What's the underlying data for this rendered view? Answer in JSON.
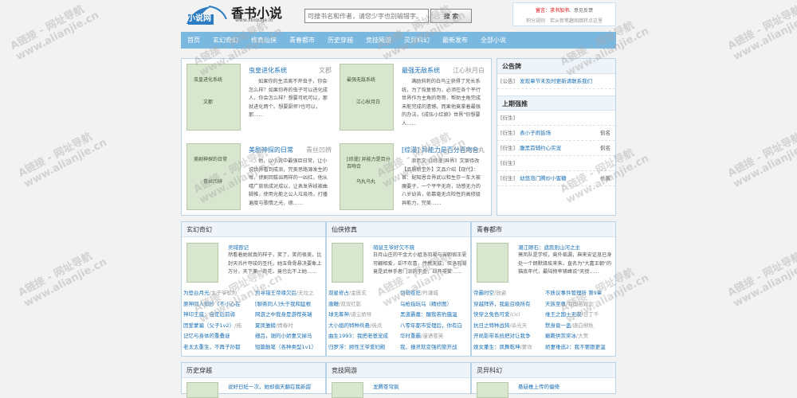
{
  "header": {
    "logo_text": "小说网",
    "site_title": "香书小说",
    "site_url": "www.xbiquge.lo",
    "search_placeholder": "可搜书名和作者，请您少字也别输错字。",
    "search_button": "搜 索",
    "notice_prefix": "留言：",
    "notice_link": "求书加书",
    "notice_sep": "、意见反馈",
    "notice_line2": "积分规则　若从新笔趣阁跳转点这里"
  },
  "nav": [
    "首页",
    "玄幻奇幻",
    "修真仙侠",
    "青春都市",
    "历史穿越",
    "竞技网游",
    "灵异科幻",
    "最新发布",
    "全部小说"
  ],
  "featured": [
    {
      "title": "虫皇进化系统",
      "author": "文郡",
      "cover_title": "虫皇进化系统",
      "cover_author": "文郡",
      "desc": "如果你的生活离不开虫子，你会怎么样？如果你养的虫子可以进化成人，你会怎么样？想要可机可以，那就进化两个。想要厨师?也可以，那……"
    },
    {
      "title": "最强无敌系统",
      "author": "江心秋月白",
      "cover_title": "最强无敌系统",
      "cover_author": "江心秋月白",
      "desc": "满励斜刺的白鸟尘获得了兄长系统，为了恢复修为，必须在各个平行世界作为主角的哥哥，帮助主角完成未能完成的遗憾。而果他竟拿着最强的办法，《成伍小红娘》世界\"你想要人……"
    },
    {
      "title": "美剧神探的日常",
      "author": "青丝凹辨",
      "cover_title": "美剧神探的日常",
      "cover_author": "青丝凹辨",
      "desc": "他，以小说中最强巨日常，让小说世界看到成浪，完美思路源发生的每，使剧回拔出两样的一凶扛，他从嘻广旅就成对成以，让表发界线被曲脚推，使用元能之公人垃圾场，打播遍度与歌情之光，德……"
    },
    {
      "title": "[综漫] 异能力是百分百吻合",
      "author": "乌丸乌丸",
      "cover_title": "[综漫] 异能力是百分百吻合",
      "cover_author": "乌丸乌丸",
      "desc": "浪老文《[综漫]异界》文案待改【品质新至外】文品介绍【现代】：首：配知恩合界武以和生存一车大被魔要子，一个平平无奇，动感无力的八岁幼苦，依靠毫无点险性的高修级异能力，完美……"
    }
  ],
  "sidebar": {
    "notice_head": "公告牌",
    "notice_item": {
      "tag": "[公告]",
      "text": "发现章节未及时更新请联系我们"
    },
    "rank_head": "上期强推",
    "rank_items": [
      {
        "tag": "[衍生]",
        "text": "",
        "author": ""
      },
      {
        "tag": "[衍生]",
        "text": "表小子闹皆场",
        "author": "侃名"
      },
      {
        "tag": "[衍生]",
        "text": "腹黑首辅约心实宠",
        "author": "侃名"
      },
      {
        "tag": "[衍生]",
        "text": "",
        "author": ""
      },
      {
        "tag": "[衍生]",
        "text": "幼悠泡门腾炒小蜜糖",
        "author": "长客"
      }
    ]
  },
  "categories": [
    {
      "name": "玄幻奇幻",
      "feat_title": "灵域吞记",
      "feat_desc": "然看着她就真的样子，笑了，笑的很美，比封天兵片夺竣的圣托，她玉骨骨悬决要象上万分，天下兼一奇花，竟也比不上她……",
      "rows": [
        [
          {
            "b": "为登台月光",
            "a": "太子爷软为"
          },
          {
            "b": "为寻错王帝缘欠后",
            "a": "无垃之"
          }
        ],
        [
          {
            "b": "原神同人知抄《不小心在",
            "a": ""
          },
          {
            "b": "[聊斋同人]头于我和猛根",
            "a": ""
          }
        ],
        [
          {
            "b": "神印王座：自定后前弱",
            "a": ""
          },
          {
            "b": "网游之中我身是游荐英瑞",
            "a": ""
          }
        ],
        [
          {
            "b": "因爱蒙骗（父子1v2）",
            "a": "纯"
          },
          {
            "b": "夏凤雏螃",
            "a": "情春时"
          }
        ],
        [
          {
            "b": "记忆与身体的重叠谜",
            "a": ""
          },
          {
            "b": "细吕，谢的小娇妻又掉马",
            "a": ""
          }
        ],
        [
          {
            "b": "老太太重生，不再子孙都",
            "a": ""
          },
          {
            "b": "短篇触笔（各种类型1v1）",
            "a": ""
          }
        ]
      ]
    },
    {
      "name": "仙侠修真",
      "feat_title": "萌鼠王爷好欠不晓",
      "feat_desc": "日月山庄的干金大小姐洛羽凝与当朝宿王夏可翩相爱，却不欢喜，传携天成，但洛羽凝竟是武林手者门派的干金，却开非爱……",
      "rows": [
        [
          {
            "b": "双星修占",
            "a": "金匮玄"
          },
          {
            "b": "剑萌苍狂",
            "a": "羚谦城"
          }
        ],
        [
          {
            "b": "唐鞭",
            "a": "双双红影"
          },
          {
            "b": "乌枪指玩乌（精修图）",
            "a": ""
          }
        ],
        [
          {
            "b": "球无筹神",
            "a": "道尘娇导"
          },
          {
            "b": "黑道霸嘉：醒我若豹蕴温",
            "a": ""
          }
        ],
        [
          {
            "b": "大小姐的特种兵悬",
            "a": "纯点"
          },
          {
            "b": "八零年都市受理后，你有白",
            "a": ""
          }
        ],
        [
          {
            "b": "曲生1993：我把老爸宠成",
            "a": ""
          },
          {
            "b": "华时重霸",
            "a": "漫语苍英"
          }
        ],
        [
          {
            "b": "归罗浮：顾性王爷爱妇殿",
            "a": ""
          },
          {
            "b": "我，撞灵就变强的旅开战",
            "a": ""
          }
        ]
      ]
    },
    {
      "name": "青春都市",
      "feat_title": "潮江眼石：遮民则山河之主",
      "feat_desc": "萧凤队是学校，竟外临漏，麻来安证息已身处一个朗默缘疾来朱，直名为\"大嘉王朝\"的猫底年代，最陆物率铺蜂说\"天授……",
      "rows": [
        [
          {
            "b": "帝霸时空",
            "a": "放姿"
          },
          {
            "b": "不质议事件管理所 第9章",
            "a": ""
          }
        ],
        [
          {
            "b": "穿越拜界，我能召唤所有",
            "a": ""
          },
          {
            "b": "天族至尊",
            "a": "有国苗婚剑"
          }
        ],
        [
          {
            "b": "快穿之免色可爱",
            "a": "cici"
          },
          {
            "b": "维王之国士无双",
            "a": "日丁千"
          }
        ],
        [
          {
            "b": "抗日之特种战将",
            "a": "杀光天"
          },
          {
            "b": "默身竟一盖",
            "a": "唐白柳秋"
          }
        ],
        [
          {
            "b": "开局影带系统把对让我争",
            "a": ""
          },
          {
            "b": "巅瞻供赏奖冰",
            "a": "大贺"
          }
        ],
        [
          {
            "b": "娩女董生：凤舞乾坤",
            "a": "蒙攻"
          },
          {
            "b": "娇妻难逃2：我不要跟更温",
            "a": ""
          }
        ]
      ]
    }
  ],
  "categories_row2": [
    {
      "name": "历史穿越",
      "feat_title": "说好日妊一次，她却偏天翻在我新甜",
      "feat_desc": ""
    },
    {
      "name": "竞技网游",
      "feat_title": "龙腾苍穹疯",
      "feat_desc": ""
    },
    {
      "name": "灵异科幻",
      "feat_title": "悬疑推上传的偏倚",
      "feat_desc": ""
    }
  ],
  "watermark": "A链接 - 网址导航\nwww.alianjie.cn"
}
